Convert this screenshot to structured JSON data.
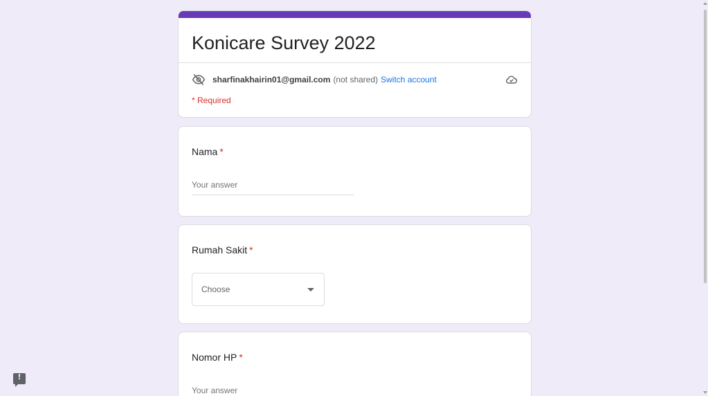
{
  "form": {
    "title": "Konicare Survey 2022",
    "accent_color": "#673ab7"
  },
  "account": {
    "email": "sharfinakhairin01@gmail.com",
    "note": "(not shared)",
    "switch_label": "Switch account",
    "icons": [
      "eye-off-icon",
      "cloud-icon"
    ]
  },
  "required_note": "* Required",
  "questions": [
    {
      "label": "Nama",
      "required_mark": "*",
      "type": "text",
      "placeholder": "Your answer"
    },
    {
      "label": "Rumah Sakit",
      "required_mark": "*",
      "type": "select",
      "selected": "Choose"
    },
    {
      "label": "Nomor HP",
      "required_mark": "*",
      "type": "text",
      "placeholder": "Your answer"
    }
  ],
  "feedback": {
    "icon": "feedback-icon"
  }
}
